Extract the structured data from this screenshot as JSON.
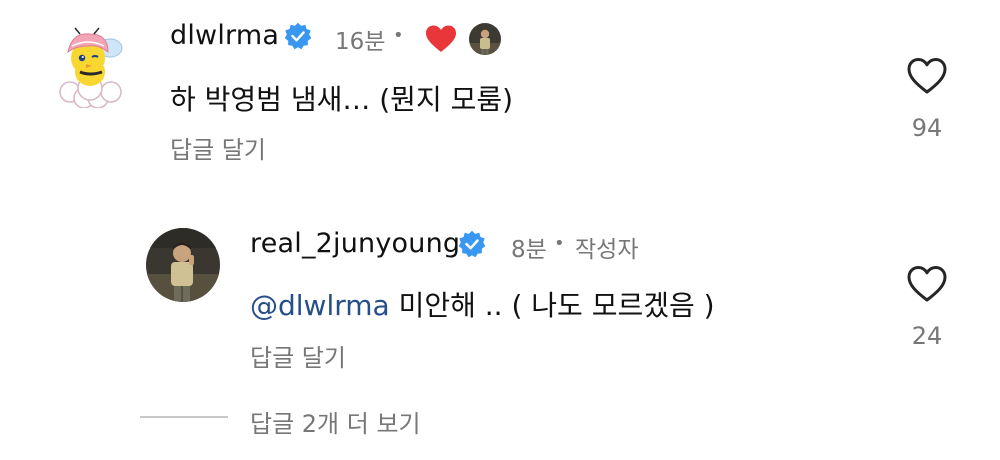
{
  "colors": {
    "text": "#111111",
    "muted": "#777777",
    "verified": "#3897f0",
    "heart_red": "#e8363b",
    "mention": "#264f8a"
  },
  "comments": [
    {
      "username": "dlwlrma",
      "verified": true,
      "time": "16분",
      "creator_liked": true,
      "text": "하 박영범 냄새… (뭔지 모룸)",
      "reply_label": "답글 달기",
      "like_count": "94",
      "avatar_icon": "cartoon-bird-avatar"
    },
    {
      "username": "real_2junyoung",
      "verified": true,
      "time": "8분",
      "badge": "작성자",
      "mention": "@dlwlrma",
      "text": " 미안해 .. ( 나도 모르겠음 )",
      "reply_label": "답글 달기",
      "like_count": "24",
      "avatar_icon": "person-photo-avatar"
    }
  ],
  "view_replies_label": "답글 2개 더 보기"
}
